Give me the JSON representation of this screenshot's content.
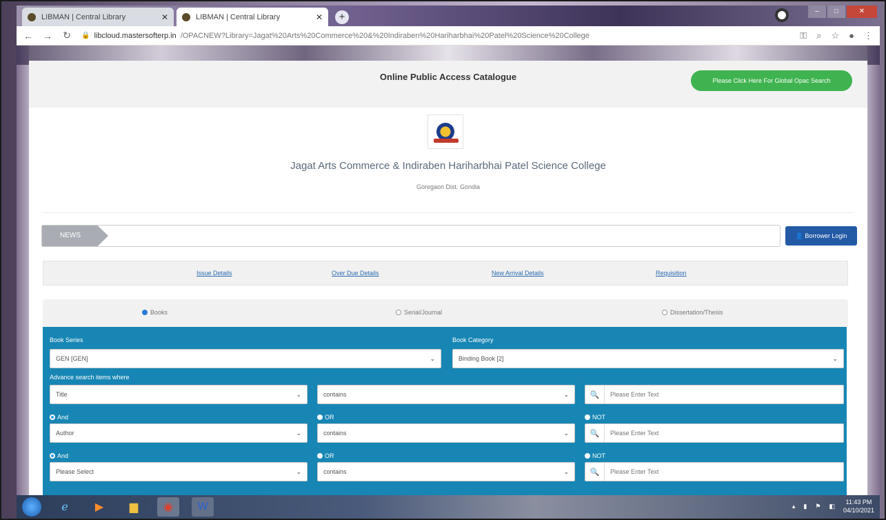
{
  "browser": {
    "tabs": [
      {
        "label": "LIBMAN | Central Library",
        "active": false
      },
      {
        "label": "LIBMAN | Central Library",
        "active": true
      }
    ],
    "new_tab_symbol": "+",
    "url_host": "libcloud.mastersofterp.in",
    "url_path": "/OPACNEW?Library=Jagat%20Arts%20Commerce%20&%20Indiraben%20Hariharbhai%20Patel%20Science%20College",
    "icons": [
      "back-icon",
      "forward-icon",
      "reload-icon",
      "lock-icon",
      "key-icon",
      "zoom-icon",
      "star-icon",
      "profile-icon",
      "menu-icon"
    ]
  },
  "header": {
    "title": "Online Public Access Catalogue",
    "global_search_label": "Please Click Here For Global Opac Search"
  },
  "college": {
    "name": "Jagat Arts Commerce & Indiraben Hariharbhai Patel Science College",
    "location": "Goregaon Dist. Gondia"
  },
  "news": {
    "tag": "NEWS",
    "borrower_login": "Borrower Login"
  },
  "links": {
    "issue": "Issue Details",
    "overdue": "Over Due Details",
    "new_arrival": "New Arrival Details",
    "requisition": "Requisition"
  },
  "material_types": {
    "books": "Books",
    "serial": "Serial/Journal",
    "dissertation": "Dissertation/Thesis",
    "selected": "Books"
  },
  "search": {
    "book_series_label": "Book Series",
    "book_series_value": "GEN [GEN]",
    "book_category_label": "Book Category",
    "book_category_value": "Binding Book [2]",
    "advance_label": "Advance search items where",
    "rows": [
      {
        "field": "Title",
        "operator": "contains",
        "placeholder": "Please Enter Text"
      },
      {
        "field": "Author",
        "operator": "contains",
        "placeholder": "Please Enter Text"
      },
      {
        "field": "Please Select",
        "operator": "contains",
        "placeholder": "Please Enter Text"
      }
    ],
    "logic": {
      "and": "And",
      "or": "OR",
      "not": "NOT"
    }
  },
  "taskbar": {
    "time": "11:43 PM",
    "date": "04/10/2021"
  }
}
